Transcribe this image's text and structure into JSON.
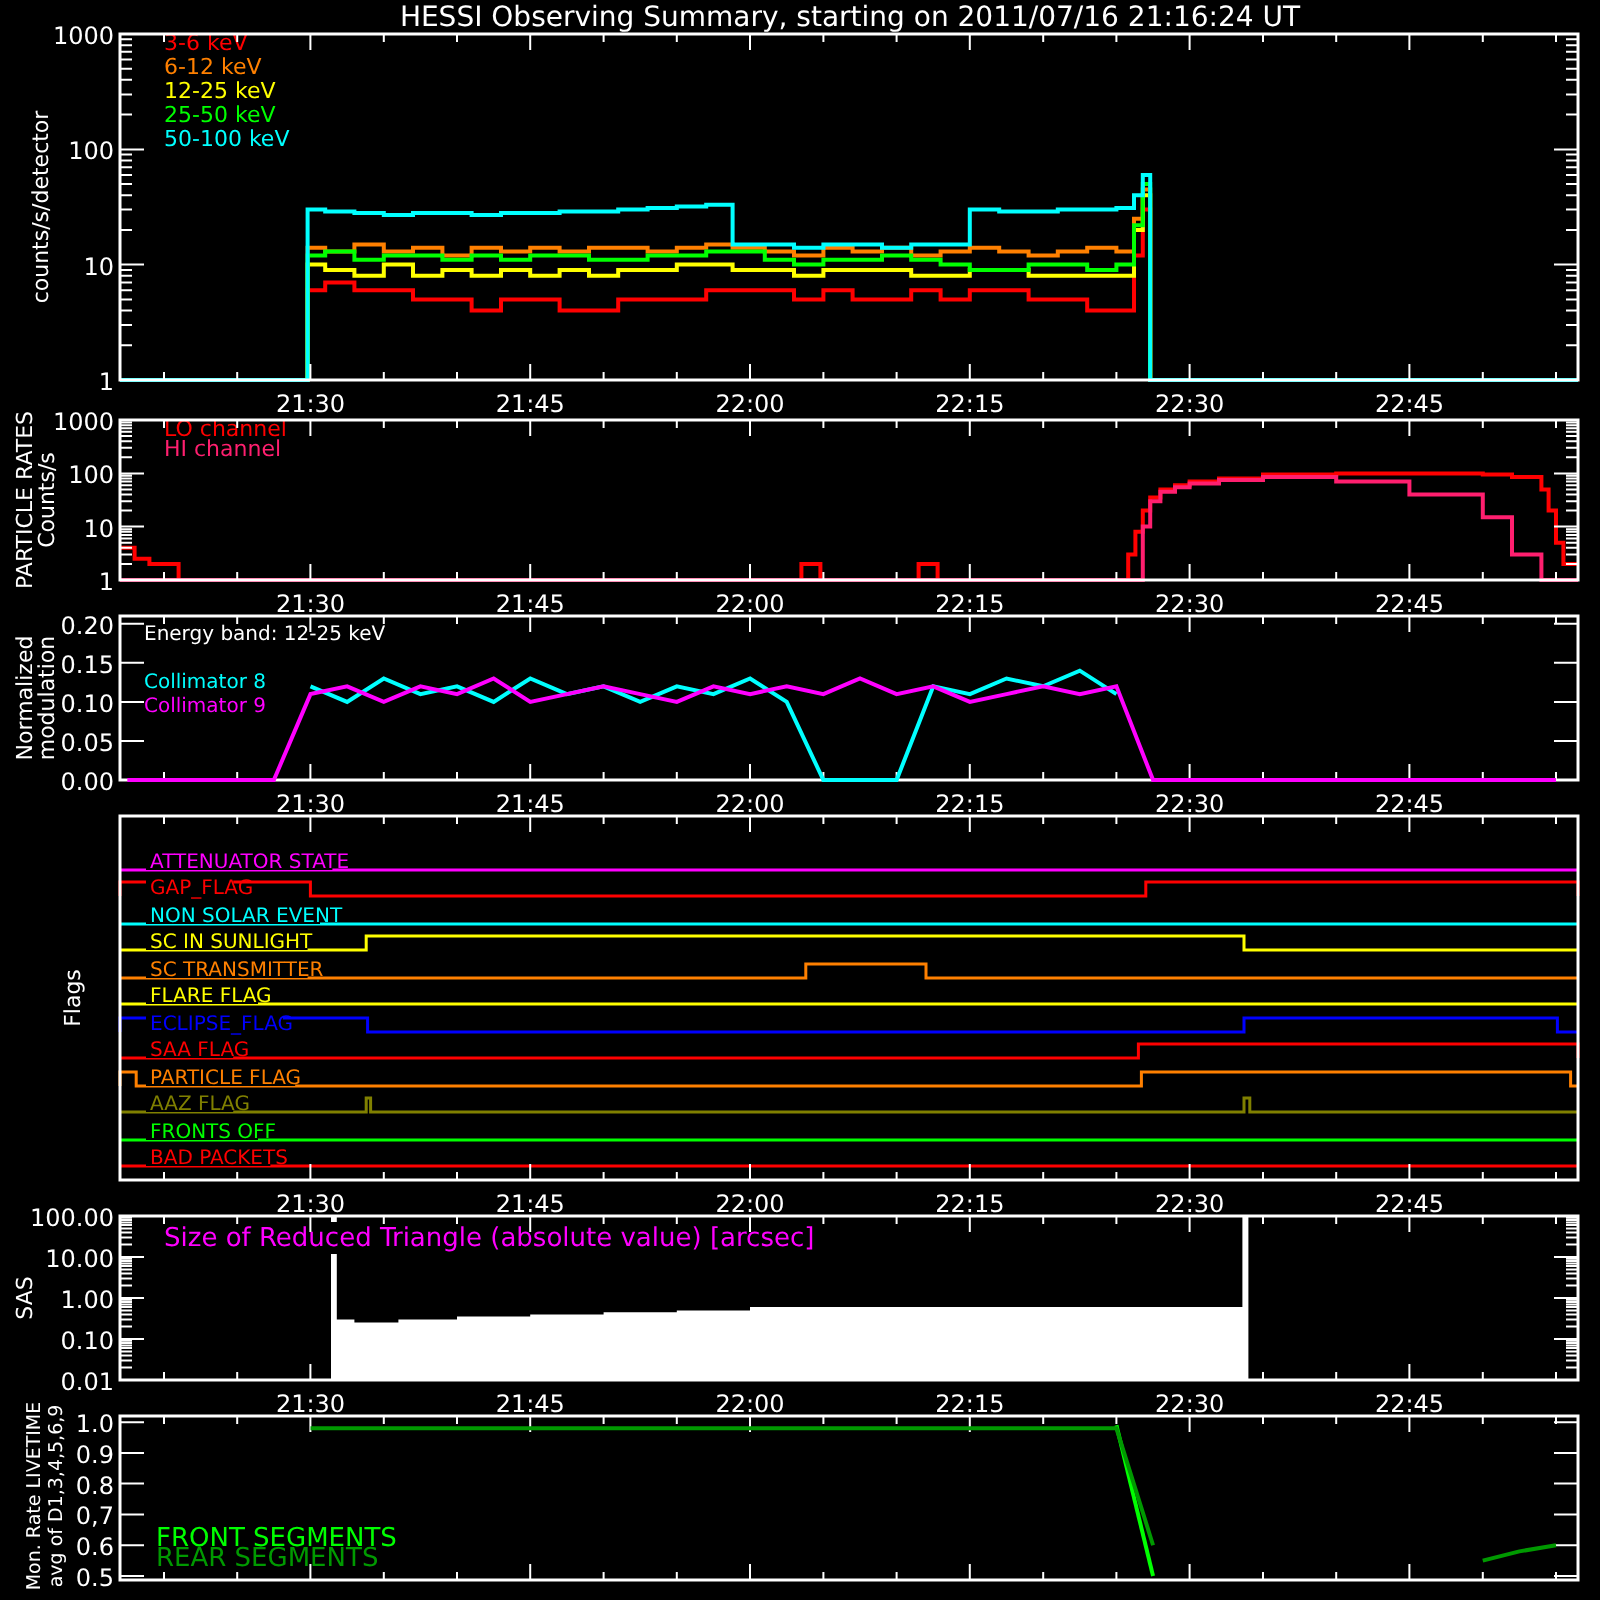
{
  "title": "HESSI Observing Summary, starting on 2011/07/16 21:16:24 UT",
  "panels": [
    {
      "kind": "log_plot",
      "ylabel": "counts/s/detector",
      "y_tick_labels": [
        "1000",
        "100",
        "10",
        "1"
      ],
      "time_labels": [
        "21:30",
        "21:45",
        "22:00",
        "22:15",
        "22:30",
        "22:45"
      ],
      "legend": [
        {
          "label": "3-6 keV",
          "color": "#ff0000"
        },
        {
          "label": "6-12 keV",
          "color": "#ff8000"
        },
        {
          "label": "12-25 keV",
          "color": "#ffff00"
        },
        {
          "label": "25-50 keV",
          "color": "#00ff00"
        },
        {
          "label": "50-100 keV",
          "color": "#00ffff"
        }
      ]
    },
    {
      "kind": "log_plot",
      "ylabel": "PARTICLE RATES",
      "ylabel_2": "Counts/s",
      "y_tick_labels": [
        "1000",
        "100",
        "10",
        "1"
      ],
      "time_labels": [
        "21:30",
        "21:45",
        "22:00",
        "22:15",
        "22:30",
        "22:45"
      ],
      "legend": [
        {
          "label": "LO channel",
          "color": "#ff0000"
        },
        {
          "label": "HI channel",
          "color": "#ff1f6f"
        }
      ]
    },
    {
      "kind": "chart",
      "ylabel": "Normalized",
      "ylabel_2": "modulation",
      "chart_data": {
        "type": "line",
        "ylim": [
          0,
          0.21
        ],
        "annotations": [
          {
            "text": "Energy band: 12-25 keV"
          }
        ],
        "categories": [
          null,
          null,
          null,
          null,
          null,
          "21:30",
          null,
          null,
          null,
          null,
          null,
          "21:45",
          null,
          null,
          null,
          null,
          null,
          "22:00",
          null,
          null,
          null,
          null,
          null,
          "22:15",
          null,
          null,
          null,
          null,
          null,
          "22:30",
          null,
          null,
          null,
          null,
          null,
          "22:45",
          null,
          null,
          null,
          null
        ],
        "yticks": [
          {
            "value": 0,
            "label": "0.00"
          },
          {
            "value": 0.05,
            "label": "0.05"
          },
          {
            "value": 0.1,
            "label": "0.10"
          },
          {
            "value": 0.15,
            "label": "0.15"
          },
          {
            "value": 0.2,
            "label": "0.20"
          }
        ],
        "series": [
          {
            "name": "Collimator 8",
            "color": "#00ffff",
            "values": [
              null,
              null,
              null,
              null,
              null,
              0.12,
              0.1,
              0.13,
              0.11,
              0.12,
              0.1,
              0.13,
              0.11,
              0.12,
              0.1,
              0.12,
              0.11,
              0.13,
              0.1,
              0,
              0,
              0,
              0.12,
              0.11,
              0.13,
              0.12,
              0.14,
              0.11,
              null,
              null,
              null,
              null,
              null,
              null,
              null,
              null,
              null,
              null,
              null,
              null
            ]
          },
          {
            "name": "Collimator 9",
            "color": "#ff00ff",
            "values": [
              0,
              0,
              0,
              0,
              0,
              0.11,
              0.12,
              0.1,
              0.12,
              0.11,
              0.13,
              0.1,
              0.11,
              0.12,
              0.11,
              0.1,
              0.12,
              0.11,
              0.12,
              0.11,
              0.13,
              0.11,
              0.12,
              0.1,
              0.11,
              0.12,
              0.11,
              0.12,
              0,
              0,
              0,
              0,
              0,
              0,
              0,
              0,
              0,
              0,
              0,
              0
            ]
          }
        ]
      }
    },
    {
      "kind": "flags",
      "ylabel": "Flags",
      "time_labels": [
        "21:30",
        "21:45",
        "22:00",
        "22:15",
        "22:30",
        "22:45"
      ],
      "flags": [
        {
          "label": "ATTENUATOR STATE",
          "color": "#ff00ff"
        },
        {
          "label": "GAP_FLAG",
          "color": "#ff0000"
        },
        {
          "label": "NON SOLAR EVENT",
          "color": "#00ffff"
        },
        {
          "label": "SC IN SUNLIGHT",
          "color": "#ffff00"
        },
        {
          "label": "SC TRANSMITTER",
          "color": "#ff8000"
        },
        {
          "label": "FLARE FLAG",
          "color": "#ffff00"
        },
        {
          "label": "ECLIPSE_FLAG",
          "color": "#0000ff"
        },
        {
          "label": "SAA FLAG",
          "color": "#ff0000"
        },
        {
          "label": "PARTICLE FLAG",
          "color": "#ff8000"
        },
        {
          "label": "AAZ FLAG",
          "color": "#808000"
        },
        {
          "label": "FRONTS OFF",
          "color": "#00ff00"
        },
        {
          "label": "BAD PACKETS",
          "color": "#ff0000"
        }
      ]
    },
    {
      "kind": "log_plot",
      "ylabel": "SAS",
      "title": "Size of Reduced Triangle (absolute value) [arcsec]",
      "y_tick_labels": [
        "100.00",
        "10.00",
        "1.00",
        "0.10",
        "0.01"
      ],
      "time_labels": [
        "21:30",
        "21:45",
        "22:00",
        "22:15",
        "22:30",
        "22:45"
      ]
    },
    {
      "kind": "chart",
      "ylabel": "Mon. Rate LIVETIME",
      "ylabel_2": "avg of D1,3,4,5,6,9",
      "chart_data": {
        "type": "line",
        "ylim": [
          0.487,
          1.02
        ],
        "categories": [
          null,
          null,
          null,
          null,
          null,
          null,
          null,
          null,
          null,
          null,
          null,
          null,
          null,
          null,
          null,
          null,
          null,
          null,
          null,
          null,
          null,
          null,
          null,
          null,
          null,
          null,
          null,
          null,
          null,
          null,
          null,
          null,
          null,
          null,
          null,
          null,
          null,
          null,
          null,
          null
        ],
        "yticks": [
          {
            "value": 0.5,
            "label": "0.5"
          },
          {
            "value": 0.6,
            "label": "0.6"
          },
          {
            "value": 0.7,
            "label": "0,7"
          },
          {
            "value": 0.8,
            "label": "0.8"
          },
          {
            "value": 0.9,
            "label": "0.9"
          },
          {
            "value": 1.0,
            "label": "1.0"
          }
        ],
        "series": [
          {
            "name": "FRONT SEGMENTS",
            "color": "#00ff00",
            "values": [
              null,
              null,
              null,
              null,
              null,
              null,
              null,
              null,
              null,
              null,
              null,
              null,
              null,
              null,
              null,
              null,
              null,
              null,
              null,
              null,
              null,
              null,
              null,
              null,
              null,
              null,
              null,
              0.99,
              0.5,
              null,
              null,
              null,
              null,
              null,
              null,
              null,
              null,
              null,
              null,
              null
            ]
          },
          {
            "name": "REAR SEGMENTS",
            "color": "#009900",
            "values": [
              null,
              null,
              null,
              null,
              null,
              0.98,
              0.98,
              0.98,
              0.98,
              0.98,
              0.98,
              0.98,
              0.98,
              0.98,
              0.98,
              0.98,
              0.98,
              0.98,
              0.98,
              0.98,
              0.98,
              0.98,
              0.98,
              0.98,
              0.98,
              0.98,
              0.98,
              0.98,
              0.6,
              null,
              null,
              null,
              null,
              null,
              null,
              null,
              null,
              0.55,
              0.58,
              0.6
            ]
          }
        ]
      }
    }
  ]
}
